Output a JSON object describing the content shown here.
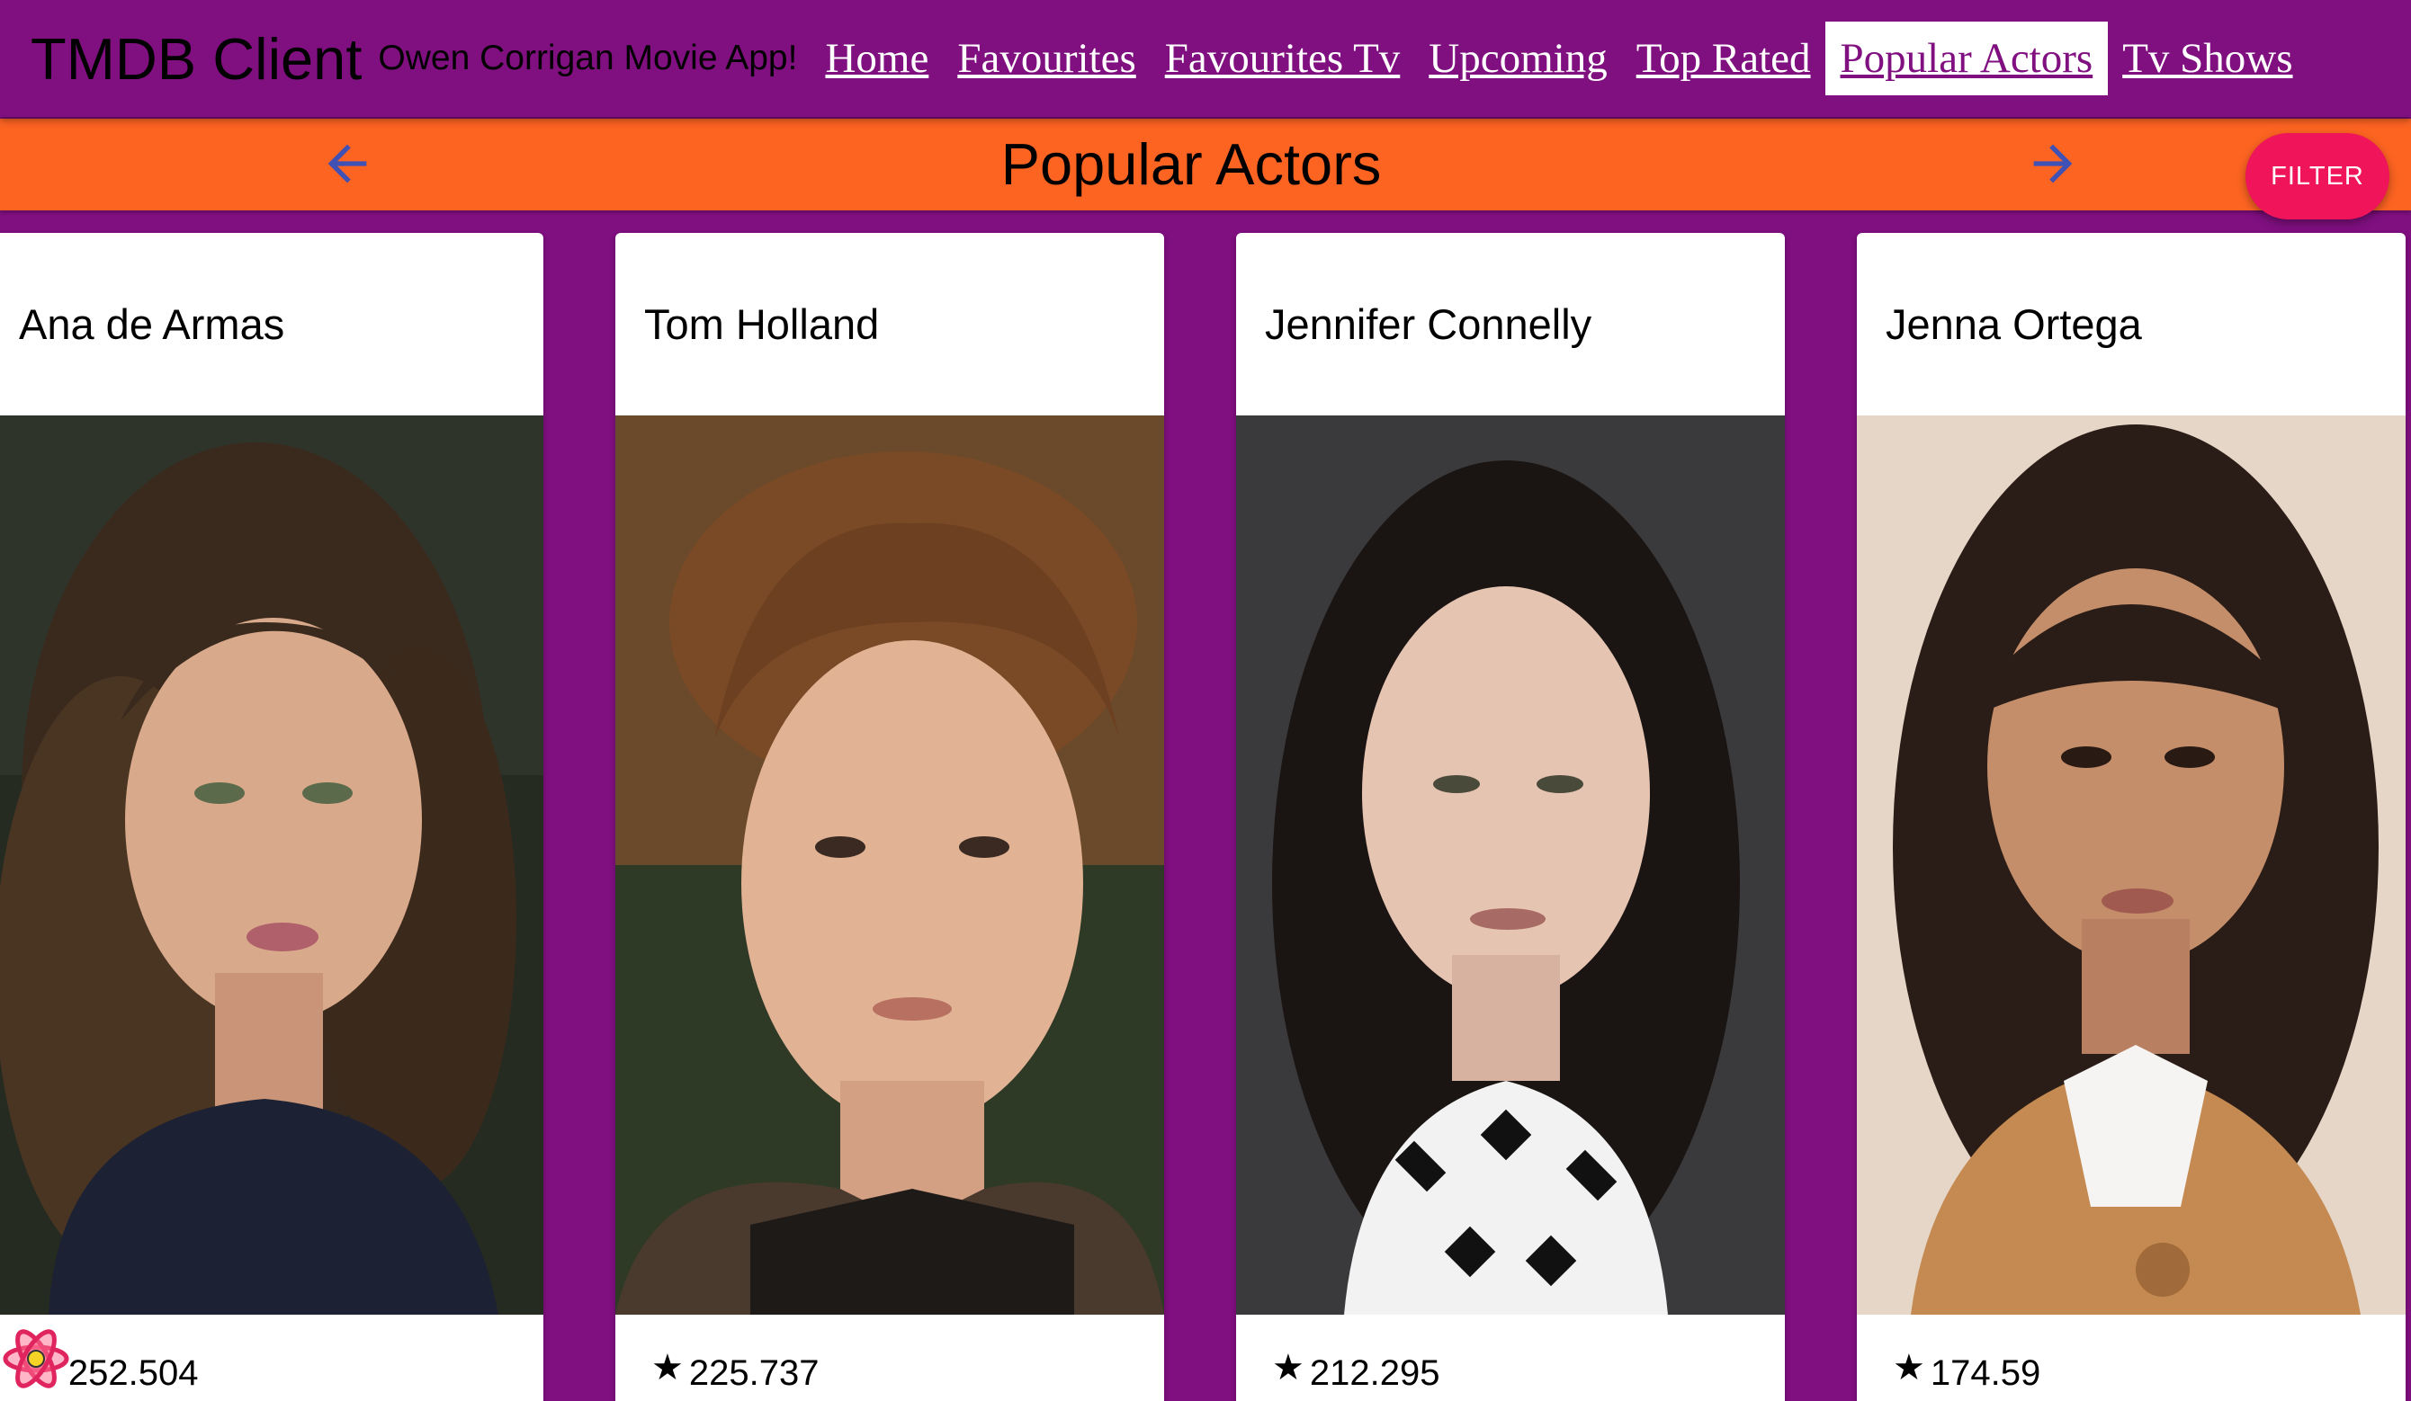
{
  "navbar": {
    "brand": "TMDB Client",
    "tagline": "Owen Corrigan Movie App!",
    "links": [
      {
        "label": "Home"
      },
      {
        "label": "Favourites"
      },
      {
        "label": "Favourites Tv"
      },
      {
        "label": "Upcoming"
      },
      {
        "label": "Top Rated"
      },
      {
        "label": "Popular Actors",
        "active": true
      },
      {
        "label": "Tv Shows"
      }
    ]
  },
  "header": {
    "title": "Popular Actors",
    "back_icon": "arrow-left-icon",
    "forward_icon": "arrow-right-icon",
    "filter_label": "FILTER"
  },
  "actors": [
    {
      "name": "Ana de Armas",
      "popularity": "252.504"
    },
    {
      "name": "Tom Holland",
      "popularity": "225.737"
    },
    {
      "name": "Jennifer Connelly",
      "popularity": "212.295"
    },
    {
      "name": "Jenna Ortega",
      "popularity": "174.59"
    }
  ],
  "colors": {
    "nav_bg": "#800f80",
    "header_bg": "#fd6422",
    "filter_bg": "#f0145a",
    "arrow": "#3f51b5"
  }
}
